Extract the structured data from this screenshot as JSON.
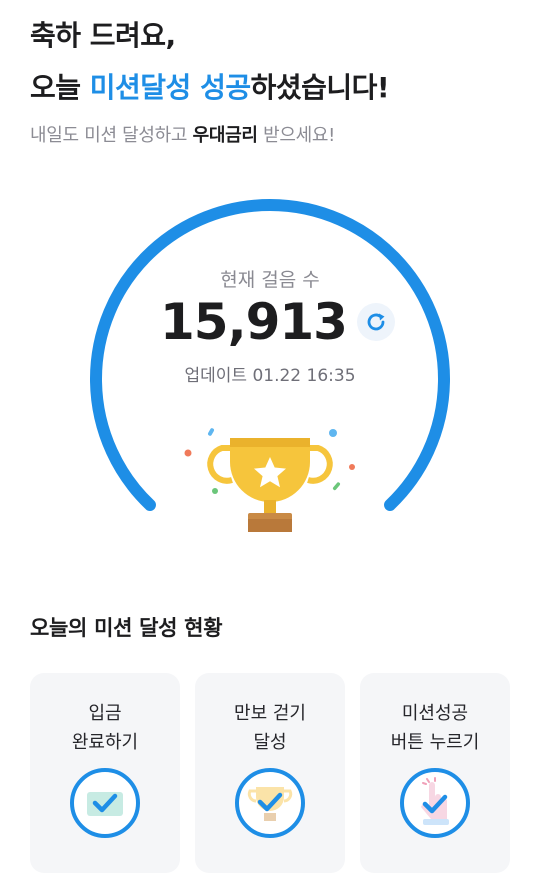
{
  "headline": {
    "line1": "축하 드려요,",
    "line2_prefix": "오늘 ",
    "line2_accent": "미션달성 성공",
    "line2_suffix": "하셨습니다!"
  },
  "subtitle": {
    "prefix": "내일도 미션 달성하고 ",
    "strong": "우대금리",
    "suffix": " 받으세요!"
  },
  "gauge": {
    "label": "현재 걸음 수",
    "value": "15,913",
    "updated": "업데이트 01.22 16:35",
    "color": "#1e8ee6"
  },
  "section_title": "오늘의 미션 달성 현황",
  "missions": [
    {
      "label": "입금\n완료하기",
      "icon": "deposit-check-icon",
      "done": true
    },
    {
      "label": "만보 걷기\n달성",
      "icon": "trophy-check-icon",
      "done": true
    },
    {
      "label": "미션성공\n버튼 누르기",
      "icon": "tap-check-icon",
      "done": true
    }
  ],
  "colors": {
    "accent": "#1e8ee6",
    "trophy": "#f6c53c",
    "trophy_base": "#b9793a"
  }
}
